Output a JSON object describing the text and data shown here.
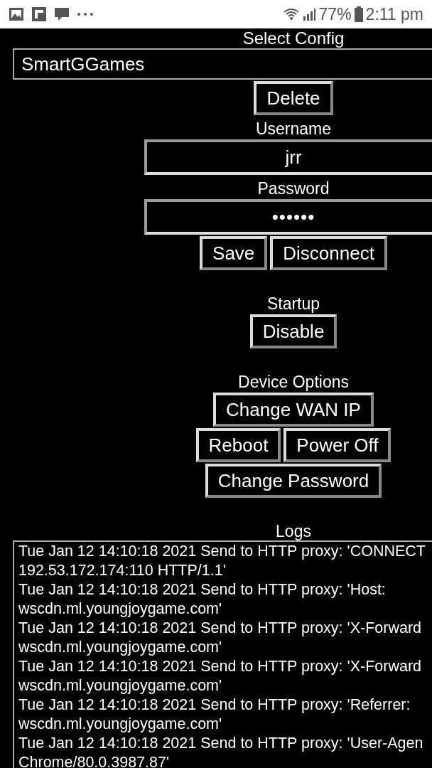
{
  "status_bar": {
    "battery": "77%",
    "time": "2:11 pm"
  },
  "config": {
    "label": "Select Config",
    "value": "SmartGGames",
    "actions": [
      "Delete"
    ]
  },
  "username": {
    "label": "Username",
    "value": "jrr"
  },
  "password": {
    "label": "Password",
    "value": "••••••"
  },
  "account_actions": [
    "Save",
    "Disconnect"
  ],
  "startup": {
    "label": "Startup",
    "actions": [
      "Disable"
    ]
  },
  "device_options": {
    "label": "Device Options",
    "rows": [
      [
        "Change WAN IP"
      ],
      [
        "Reboot",
        "Power Off"
      ],
      [
        "Change Password"
      ]
    ]
  },
  "logs": {
    "label": "Logs",
    "lines": [
      "Tue Jan 12 14:10:18 2021 Send to HTTP proxy: 'CONNECT",
      "192.53.172.174:110 HTTP/1.1'",
      "Tue Jan 12 14:10:18 2021 Send to HTTP proxy: 'Host:",
      "wscdn.ml.youngjoygame.com'",
      "Tue Jan 12 14:10:18 2021 Send to HTTP proxy: 'X-Forward",
      "wscdn.ml.youngjoygame.com'",
      "Tue Jan 12 14:10:18 2021 Send to HTTP proxy: 'X-Forward",
      "wscdn.ml.youngjoygame.com'",
      "Tue Jan 12 14:10:18 2021 Send to HTTP proxy: 'Referrer:",
      "wscdn.ml.youngjoygame.com'",
      "Tue Jan 12 14:10:18 2021 Send to HTTP proxy: 'User-Agen",
      "Chrome/80.0.3987.87'"
    ]
  }
}
